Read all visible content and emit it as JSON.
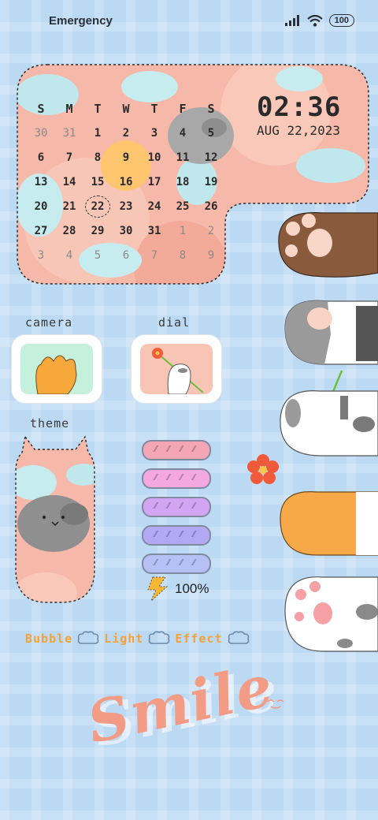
{
  "status_bar": {
    "carrier": "Emergency c",
    "battery": "100"
  },
  "calendar": {
    "weekdays": [
      "S",
      "M",
      "T",
      "W",
      "T",
      "F",
      "S"
    ],
    "weeks": [
      [
        {
          "d": "30",
          "dim": true
        },
        {
          "d": "31",
          "dim": true
        },
        {
          "d": "1"
        },
        {
          "d": "2"
        },
        {
          "d": "3"
        },
        {
          "d": "4"
        },
        {
          "d": "5"
        }
      ],
      [
        {
          "d": "6"
        },
        {
          "d": "7"
        },
        {
          "d": "8"
        },
        {
          "d": "9"
        },
        {
          "d": "10"
        },
        {
          "d": "11"
        },
        {
          "d": "12"
        }
      ],
      [
        {
          "d": "13"
        },
        {
          "d": "14"
        },
        {
          "d": "15"
        },
        {
          "d": "16"
        },
        {
          "d": "17"
        },
        {
          "d": "18"
        },
        {
          "d": "19"
        }
      ],
      [
        {
          "d": "20"
        },
        {
          "d": "21"
        },
        {
          "d": "22",
          "today": true
        },
        {
          "d": "23"
        },
        {
          "d": "24"
        },
        {
          "d": "25"
        },
        {
          "d": "26"
        }
      ],
      [
        {
          "d": "27"
        },
        {
          "d": "28"
        },
        {
          "d": "29"
        },
        {
          "d": "30"
        },
        {
          "d": "31"
        },
        {
          "d": "1",
          "dim": true
        },
        {
          "d": "2",
          "dim": true
        }
      ],
      [
        {
          "d": "3",
          "dim": true
        },
        {
          "d": "4",
          "dim": true
        },
        {
          "d": "5",
          "dim": true
        },
        {
          "d": "6",
          "dim": true
        },
        {
          "d": "7",
          "dim": true
        },
        {
          "d": "8",
          "dim": true
        },
        {
          "d": "9",
          "dim": true
        }
      ]
    ]
  },
  "clock": {
    "time": "02:36",
    "date": "AUG 22,2023"
  },
  "apps": {
    "camera": "camera",
    "dial": "dial",
    "theme": "theme"
  },
  "pills": [
    "#f4a6b4",
    "#f3a8e0",
    "#d3a4f2",
    "#b3a8f4",
    "#b7c0f4"
  ],
  "battery_widget": {
    "percent": "100%"
  },
  "effects": [
    "Bubble",
    "Light",
    "Effect"
  ],
  "decor_text": "Smile"
}
